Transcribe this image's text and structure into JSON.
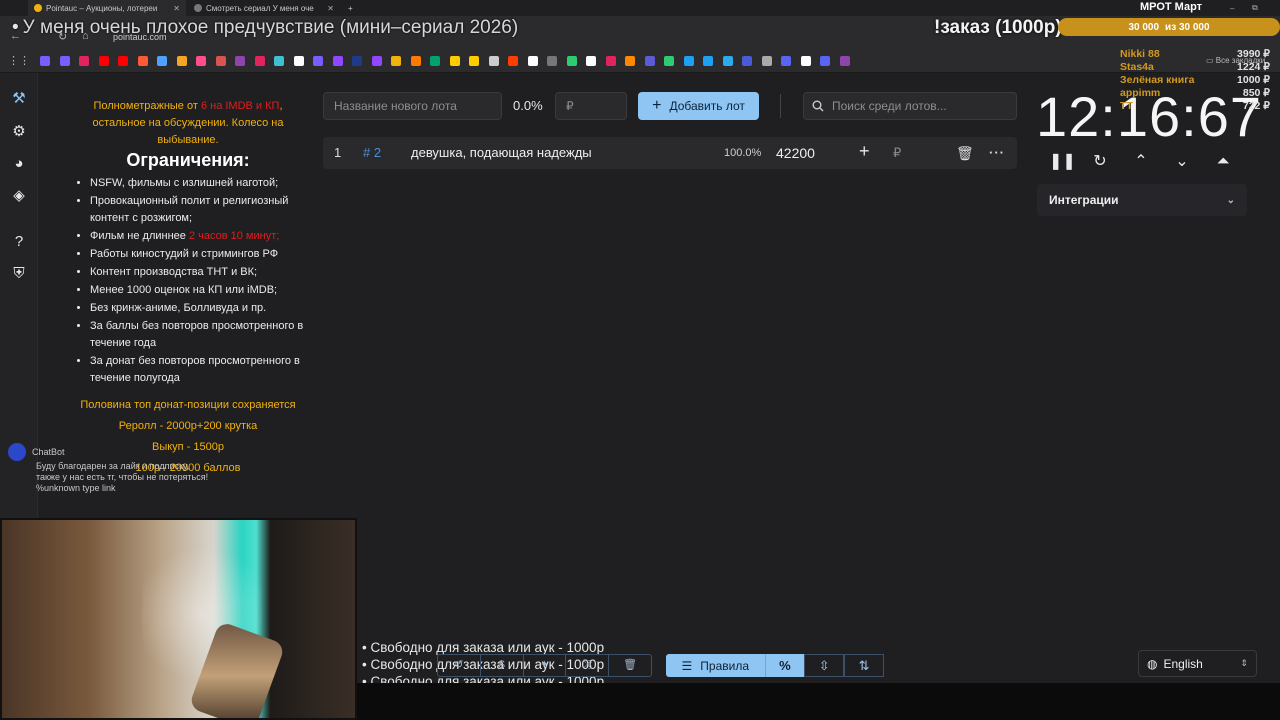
{
  "browser": {
    "tabs": [
      {
        "label": "Pointauc – Аукционы, лотереи",
        "active": true
      },
      {
        "label": "Смотреть сериал У меня оче",
        "active": false
      }
    ],
    "address": "pointauc.com",
    "all_bookmarks": "Все закладки",
    "bookmark_colors": [
      "#7b5cff",
      "#7b5cff",
      "#e0245e",
      "#ff0000",
      "#ff0000",
      "#ff5a36",
      "#4fa3ff",
      "#f5a623",
      "#ff4d8d",
      "#d9534f",
      "#8e44ad",
      "#e0245e",
      "#3ec1d3",
      "#ffffff",
      "#7b5cff",
      "#9146ff",
      "#1e3a8a",
      "#9146ff",
      "#f2b20d",
      "#ff7a00",
      "#00a36c",
      "#ffcc00",
      "#ffcc00",
      "#cccccc",
      "#ff3d00",
      "#ffffff",
      "#777777",
      "#2ecc71",
      "#ffffff",
      "#e0245e",
      "#ff8800",
      "#5b5bd6",
      "#2ecc71",
      "#1da1f2",
      "#1da1f2",
      "#2aabee",
      "#4a5bd6",
      "#aaaaaa",
      "#5865f2",
      "#ffffff",
      "#5865f2",
      "#8e44ad"
    ]
  },
  "overlay": {
    "stream_title": "У меня очень плохое предчувствие (мини–сериал 2026)",
    "order_label": "!заказ (1000р)",
    "goal_title": "МРОТ Март",
    "goal_current": "30 000",
    "goal_of": "из 30 000",
    "donors": [
      {
        "name": "Nikki 88",
        "value": "3990 ₽"
      },
      {
        "name": "Stas4a",
        "value": "1224 ₽"
      },
      {
        "name": "Зелёная книга",
        "value": "1000 ₽"
      },
      {
        "name": "appimm",
        "value": "850 ₽"
      },
      {
        "name": "TT",
        "value": "722 ₽"
      }
    ]
  },
  "rules": {
    "intro_pre": "Полнометражные от ",
    "intro_red": "6 на IMDB и КП",
    "intro_post": ", остальное на обсуждении. Колесо на выбывание.",
    "heading": "Ограничения:",
    "items": [
      {
        "text": "NSFW, фильмы с излишней наготой;",
        "red": ""
      },
      {
        "text": "Провокационный полит и религиозный контент с розжигом;",
        "red": ""
      },
      {
        "text": "Фильм не длиннее ",
        "red": "2 часов 10 минут;"
      },
      {
        "text": "Работы киностудий и стримингов РФ",
        "red": ""
      },
      {
        "text": "Контент производства ТНТ и ВК;",
        "red": ""
      },
      {
        "text": "Менее 1000 оценок на КП или iMDB;",
        "red": ""
      },
      {
        "text": "Без кринж-аниме, Болливуда и пр.",
        "red": ""
      },
      {
        "text": "За баллы без повторов просмотренного в течение года",
        "red": ""
      },
      {
        "text": "За донат без повторов просмотренного в течение полугода",
        "red": ""
      }
    ],
    "gold_lines": [
      "Половина топ донат-позиции сохраняется",
      "Реролл - 2000р+200 крутка",
      "Выкуп - 1500р",
      "100р - 20000 баллов"
    ]
  },
  "chatbot": {
    "name": "ChatBot",
    "lines": [
      "Буду благодарен за лайк и подписку,",
      "также у нас есть тг, чтобы не потеряться!",
      "%unknown type link"
    ]
  },
  "lot_form": {
    "name_placeholder": "Название нового лота",
    "percent": "0.0%",
    "amount_placeholder": "₽",
    "add_label": "Добавить лот",
    "search_placeholder": "Поиск среди лотов..."
  },
  "lots": [
    {
      "index": "1",
      "tag": "# 2",
      "name": "девушка, подающая надежды",
      "percent": "100.0%",
      "amount": "42200",
      "currency": "₽"
    }
  ],
  "timer": {
    "display": "12:16:67"
  },
  "integrations": {
    "label": "Интеграции"
  },
  "free_slots": [
    "• Свободно для заказа или аук - 1000р",
    "• Свободно для заказа или аук - 1000р",
    "• Свободно для заказа или аук - 1000р"
  ],
  "bottom": {
    "rules_label": "Правила",
    "percent_symbol": "%",
    "language": "English"
  }
}
